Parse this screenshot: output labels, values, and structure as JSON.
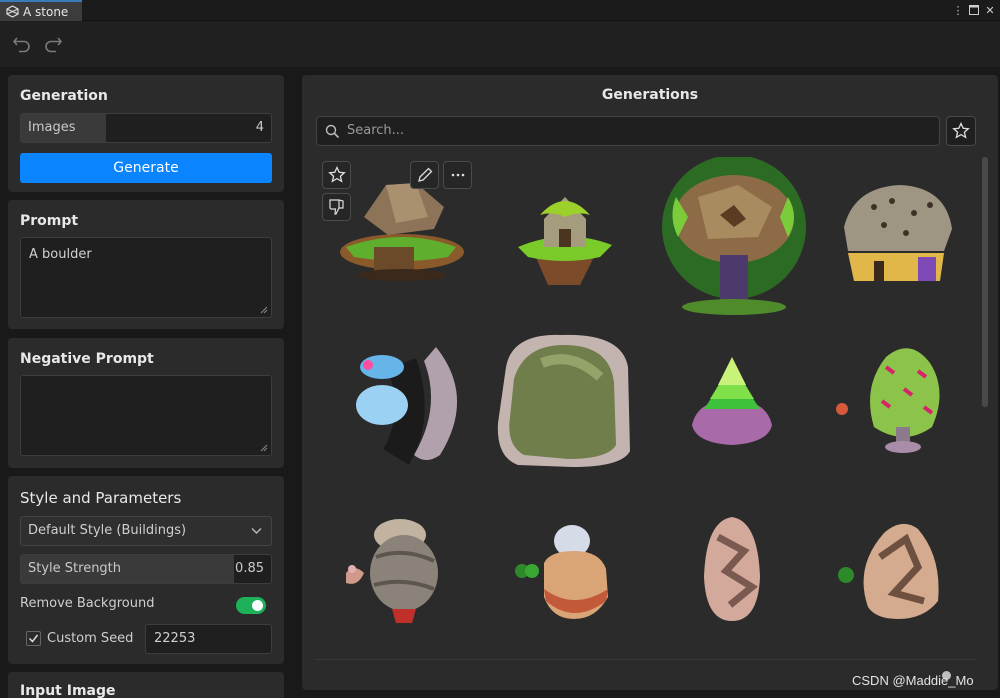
{
  "window": {
    "tab_title": "A stone"
  },
  "generation": {
    "title": "Generation",
    "images_label": "Images",
    "images_value": "4",
    "images_fraction": 0.34,
    "generate_label": "Generate"
  },
  "prompt": {
    "title": "Prompt",
    "value": "A boulder"
  },
  "negative_prompt": {
    "title": "Negative Prompt",
    "value": ""
  },
  "style": {
    "title": "Style and Parameters",
    "style_selected": "Default Style (Buildings)",
    "strength_label": "Style Strength",
    "strength_value": "0.85",
    "remove_bg_label": "Remove Background",
    "remove_bg_on": true,
    "custom_seed_label": "Custom Seed",
    "custom_seed_checked": true,
    "seed_value": "22253"
  },
  "input_image": {
    "title": "Input Image"
  },
  "generations": {
    "title": "Generations",
    "search_placeholder": "Search...",
    "images": [
      "stone-mushroom-house",
      "tree-hut-on-rock",
      "stone-mushroom-tree-house",
      "rock-cottage",
      "rainbow-stone-arch",
      "mossy-boulder",
      "green-crystal-rock",
      "pink-leaf-tree",
      "stacked-stone-creature",
      "egg-on-rock",
      "brown-egg-stone",
      "brown-rock-with-bush"
    ]
  },
  "watermark": "CSDN @Maddie_Mo",
  "colors": {
    "accent": "#0a84ff",
    "toggle_on": "#1db15a",
    "panel": "#2b2b2b"
  }
}
